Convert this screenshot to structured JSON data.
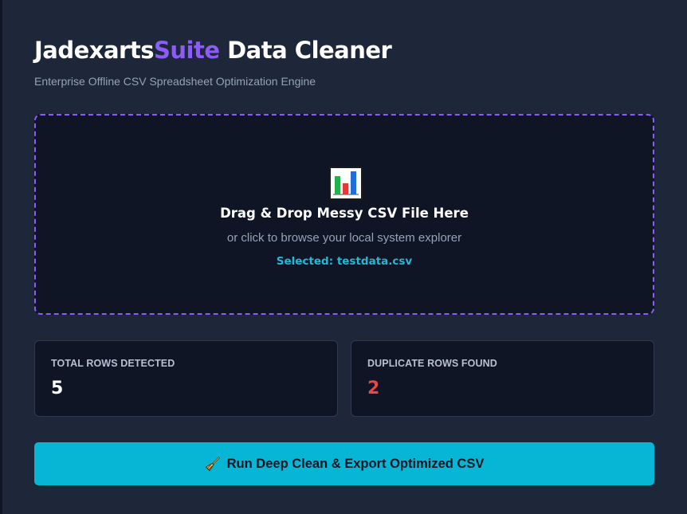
{
  "header": {
    "title_prefix": "Jadexarts",
    "title_accent": "Suite",
    "title_suffix": " Data Cleaner",
    "subtitle": "Enterprise Offline CSV Spreadsheet Optimization Engine"
  },
  "dropzone": {
    "icon": "bar-chart-icon",
    "title": "Drag & Drop Messy CSV File Here",
    "hint": "or click to browse your local system explorer",
    "selected_text": "Selected: testdata.csv"
  },
  "stats": {
    "total_rows_label": "TOTAL ROWS DETECTED",
    "total_rows_value": "5",
    "duplicate_rows_label": "DUPLICATE ROWS FOUND",
    "duplicate_rows_value": "2"
  },
  "actions": {
    "run_icon": "broom-icon",
    "run_label": "Run Deep Clean & Export Optimized CSV"
  },
  "colors": {
    "background": "#1e2639",
    "card": "#0f1524",
    "accent_purple": "#8b5cf6",
    "accent_cyan": "#06b6d4",
    "danger": "#ef4444"
  }
}
